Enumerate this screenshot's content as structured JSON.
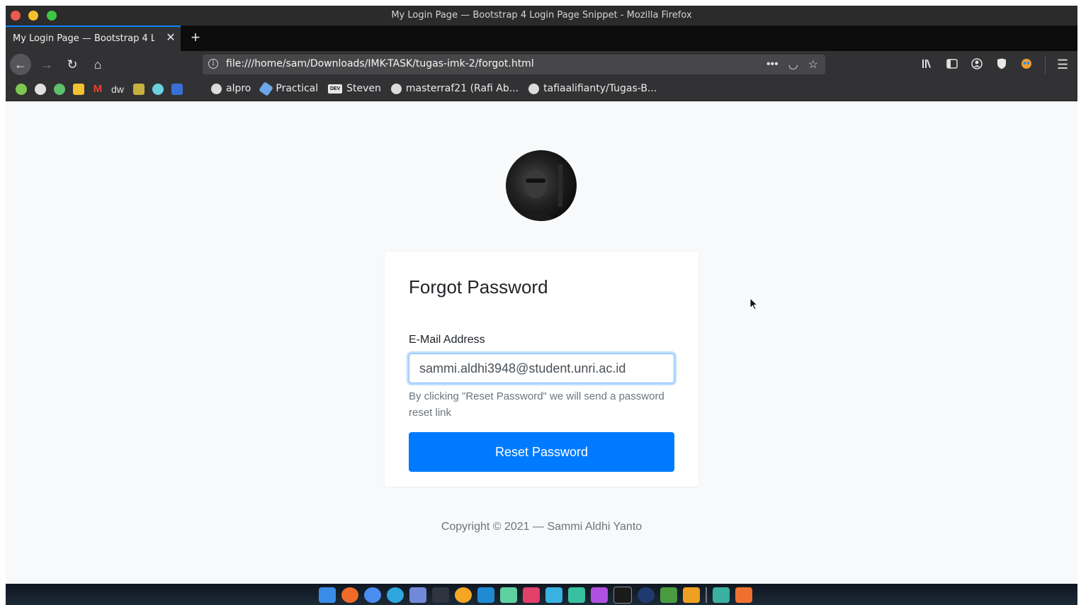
{
  "window": {
    "title": "My Login Page — Bootstrap 4 Login Page Snippet - Mozilla Firefox"
  },
  "tab": {
    "label": "My Login Page — Bootstrap 4 L",
    "close_glyph": "✕",
    "new_tab_glyph": "+"
  },
  "nav": {
    "back_glyph": "←",
    "forward_glyph": "→",
    "reload_glyph": "↻",
    "home_glyph": "⌂",
    "url": "file:///home/sam/Downloads/IMK-TASK/tugas-imk-2/forgot.html",
    "info_glyph": "i",
    "more_glyph": "•••",
    "pocket_glyph": "◡",
    "star_glyph": "☆",
    "menu_glyph": "☰"
  },
  "bookmarks": {
    "items": [
      {
        "label": "alpro",
        "icon": "github-icon"
      },
      {
        "label": "Practical",
        "icon": "rocket-icon"
      },
      {
        "label": "Steven",
        "icon": "dev-icon",
        "badge": "DEV"
      },
      {
        "label": "masterraf21 (Rafi Ab...",
        "icon": "github-icon"
      },
      {
        "label": "tafiaalifianty/Tugas-B...",
        "icon": "github-icon"
      }
    ],
    "dw_label": "dw"
  },
  "page": {
    "card_title": "Forgot Password",
    "email_label": "E-Mail Address",
    "email_value": "sammi.aldhi3948@student.unri.ac.id",
    "help_text": "By clicking \"Reset Password\" we will send a password reset link",
    "reset_button": "Reset Password",
    "footer": "Copyright © 2021 — Sammi Aldhi Yanto"
  },
  "colors": {
    "primary": "#007bff",
    "page_bg": "#f7f9fb",
    "chrome_dark": "#323234"
  }
}
